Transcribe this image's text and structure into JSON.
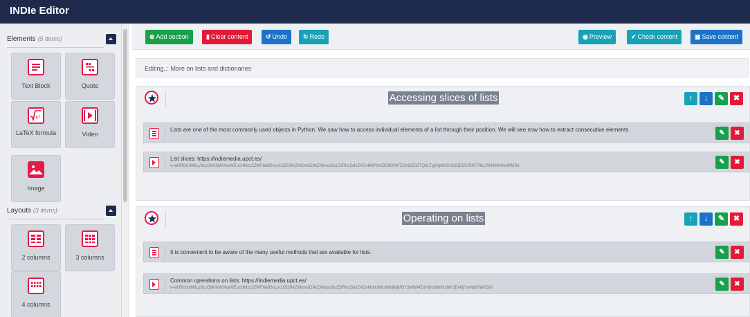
{
  "app": {
    "title": "INDIe Editor"
  },
  "sidebar": {
    "elements": {
      "title": "Elements",
      "count": "(5 items)",
      "items": [
        {
          "label": "Text Block",
          "icon": "text-block-icon"
        },
        {
          "label": "Quote",
          "icon": "quote-icon"
        },
        {
          "label": "LaTeX formula",
          "icon": "latex-formula-icon"
        },
        {
          "label": "Video",
          "icon": "video-icon"
        },
        {
          "label": "Image",
          "icon": "image-icon"
        }
      ]
    },
    "layouts": {
      "title": "Layouts",
      "count": "(3 items)",
      "items": [
        {
          "label": "2 columns",
          "icon": "two-columns-icon"
        },
        {
          "label": "3 columns",
          "icon": "three-columns-icon"
        },
        {
          "label": "4 columns",
          "icon": "four-columns-icon"
        }
      ]
    }
  },
  "toolbar": {
    "add_section": "Add section",
    "clear_content": "Clear content",
    "undo": "Undo",
    "redo": "Redo",
    "preview": "Preview",
    "check_content": "Check content",
    "save_content": "Save content"
  },
  "editing_label": "Editing..: More on lists and dictionaries",
  "sections": [
    {
      "title": "Accessing slices of lists",
      "items": [
        {
          "type": "text",
          "text": "Lists are one of the most commonly used objects in Python. We saw how to access individual elements of a list through their position. We will see now how to extract consecutive elements"
        },
        {
          "type": "video",
          "text": "List slices: https://indiemedia.upct.es/",
          "subtext": "v=aHR0cHM6Ly91cGN0NWVkaWEucHMzc3ZWFtaW5nLm1tZGRkZWdmdG9kZXMucGkzZ3RhcGdvZXOvMWVmOD9OWFZGMZE0ZTQ3LTg3NjktNDI1ODEtZGRiNTRkLWNiM0Nmd0lMDk"
        }
      ]
    },
    {
      "title": "Operating on lists",
      "items": [
        {
          "type": "text",
          "text": "It is convenient to be aware of the many useful methods  that are available for lists."
        },
        {
          "type": "video",
          "text": "Common operations on lists: https://indiemedia.upct.es/",
          "subtext": "v=aHR0cHM6Ly91cGN0NWVkaWEucHMzc3ZWFtaW5nLm1tZGRkZWdmdG9kZXMucGkzZ3RhcGdvZXOvMmU0MzNiMjNjMDY3MWI4ZmVjNzNmNzMtYjE4MjYwNjk5NWZjNi"
        }
      ]
    }
  ],
  "colors": {
    "topbar": "#1e2b4d",
    "green": "#1aa04a",
    "red": "#e31a3a",
    "teal": "#17a2b8",
    "blue": "#1a73c8",
    "accent": "#e6194b"
  }
}
